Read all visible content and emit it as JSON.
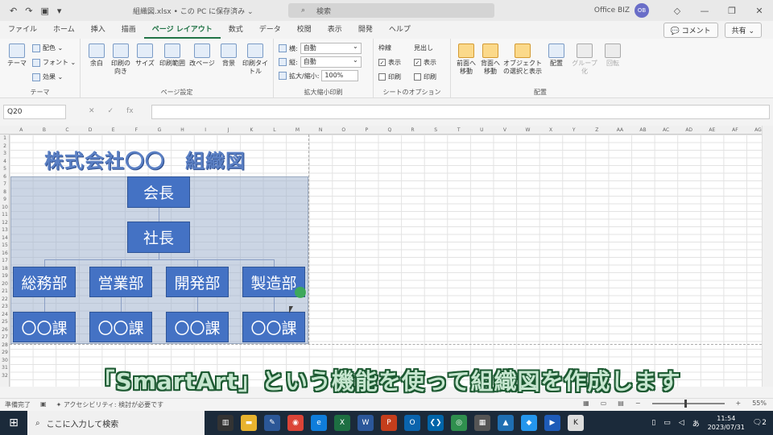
{
  "titlebar": {
    "title": "組織図.xlsx • この PC に保存済み ⌄",
    "search_placeholder": "検索",
    "user": "Office BIZ",
    "avatar_initials": "OB"
  },
  "tabs": [
    "ファイル",
    "ホーム",
    "挿入",
    "描画",
    "ページ レイアウト",
    "数式",
    "データ",
    "校閲",
    "表示",
    "開発",
    "ヘルプ"
  ],
  "active_tab": "ページ レイアウト",
  "tab_actions": {
    "comment": "コメント",
    "share": "共有 ⌄"
  },
  "ribbon": {
    "theme": {
      "label": "テーマ",
      "button": "テーマ",
      "items": [
        "配色 ⌄",
        "フォント ⌄",
        "効果 ⌄"
      ]
    },
    "page_setup": {
      "label": "ページ設定",
      "buttons": [
        "余白",
        "印刷の向き",
        "サイズ",
        "印刷範囲",
        "改ページ",
        "背景",
        "印刷タイトル"
      ]
    },
    "scale": {
      "label": "拡大縮小印刷",
      "width_label": "横:",
      "width_value": "自動",
      "height_label": "縦:",
      "height_value": "自動",
      "zoom_label": "拡大/縮小:",
      "zoom_value": "100%"
    },
    "sheet_options": {
      "label": "シートのオプション",
      "gridlines": "枠線",
      "headings": "見出し",
      "view": "表示",
      "print": "印刷"
    },
    "arrange": {
      "label": "配置",
      "buttons": [
        "前面へ移動",
        "背面へ移動",
        "オブジェクトの選択と表示",
        "配置",
        "グループ化",
        "回転"
      ]
    }
  },
  "formula_bar": {
    "cell_ref": "Q20",
    "fx": "fx"
  },
  "columns": [
    "A",
    "B",
    "C",
    "D",
    "E",
    "F",
    "G",
    "H",
    "I",
    "J",
    "K",
    "L",
    "M",
    "N",
    "O",
    "P",
    "Q",
    "R",
    "S",
    "T",
    "U",
    "V",
    "W",
    "X",
    "Y",
    "Z",
    "AA",
    "AB",
    "AC",
    "AD",
    "AE",
    "AF",
    "AG"
  ],
  "rows": [
    "1",
    "2",
    "3",
    "4",
    "5",
    "6",
    "7",
    "8",
    "9",
    "10",
    "11",
    "12",
    "13",
    "14",
    "15",
    "16",
    "17",
    "18",
    "19",
    "20",
    "21",
    "22",
    "23",
    "24",
    "25",
    "26",
    "27",
    "28",
    "29",
    "30",
    "31",
    "32"
  ],
  "sheet": {
    "heading": "株式会社〇〇　組織図",
    "org": {
      "top": "会長",
      "second": "社長",
      "departments": [
        "総務部",
        "営業部",
        "開発部",
        "製造部"
      ],
      "sections": [
        "〇〇課",
        "〇〇課",
        "〇〇課",
        "〇〇課"
      ]
    }
  },
  "caption": "「SmartArt」という機能を使って組織図を作成します",
  "status": {
    "ready": "準備完了",
    "accessibility": "アクセシビリティ: 検討が必要です",
    "zoom": "55%"
  },
  "taskbar": {
    "search_placeholder": "ここに入力して検索",
    "time": "11:54",
    "date": "2023/07/31",
    "ime": "あ",
    "notifications": "2"
  }
}
